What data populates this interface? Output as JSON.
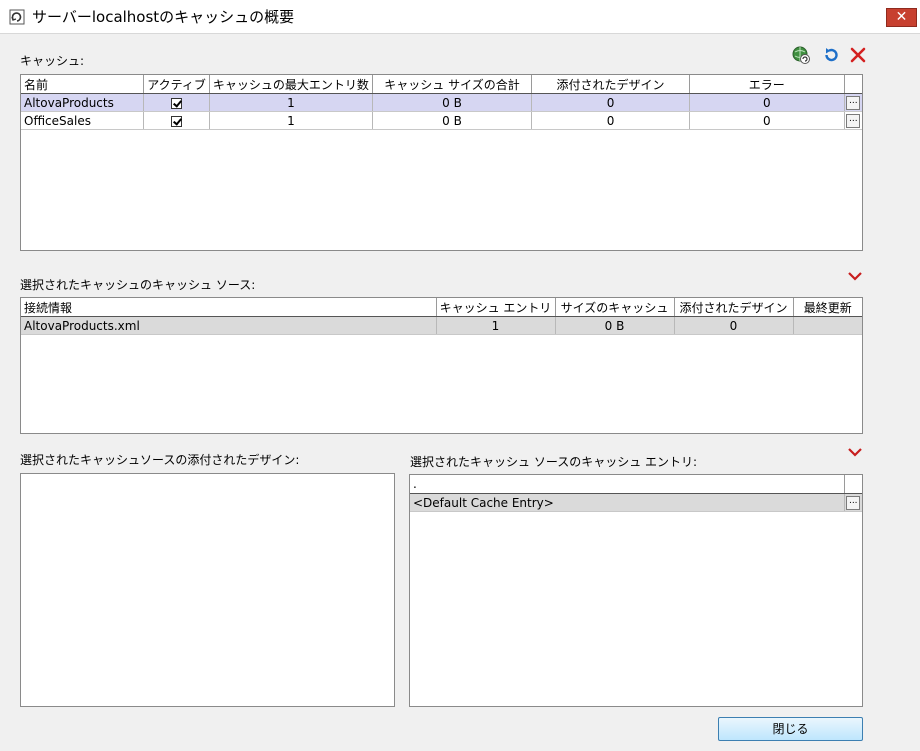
{
  "window": {
    "title": "サーバーlocalhostのキャッシュの概要",
    "close_glyph": "✕"
  },
  "caches": {
    "label": "キャッシュ:",
    "columns": [
      "名前",
      "アクティブ",
      "キャッシュの最大エントリ数",
      "キャッシュ サイズの合計",
      "添付されたデザイン",
      "エラー"
    ],
    "rows": [
      {
        "name": "AltovaProducts",
        "active": true,
        "max_entries": "1",
        "total_size": "0 B",
        "designs": "0",
        "errors": "0"
      },
      {
        "name": "OfficeSales",
        "active": true,
        "max_entries": "1",
        "total_size": "0 B",
        "designs": "0",
        "errors": "0"
      }
    ],
    "ellipsis": "..."
  },
  "toolbar": {
    "icons": [
      "globe-refresh-icon",
      "refresh-icon",
      "delete-icon"
    ],
    "accent": "#1e6fc8",
    "delete_color": "#d42020"
  },
  "sources": {
    "label": "選択されたキャッシュのキャッシュ ソース:",
    "columns": [
      "接続情報",
      "キャッシュ エントリ",
      "サイズのキャッシュ",
      "添付されたデザイン",
      "最終更新"
    ],
    "rows": [
      {
        "connection": "AltovaProducts.xml",
        "entries": "1",
        "size": "0 B",
        "designs": "0",
        "last_update": ""
      }
    ]
  },
  "designs": {
    "label": "選択されたキャッシュソースの添付されたデザイン:"
  },
  "entries": {
    "label": "選択されたキャッシュ ソースのキャッシュ エントリ:",
    "header": ".",
    "rows": [
      {
        "name": "<Default Cache Entry>"
      }
    ]
  },
  "buttons": {
    "close_label": "閉じる"
  },
  "colors": {
    "selected_row": "#d6d6f2",
    "chevron": "#c81e1e"
  }
}
